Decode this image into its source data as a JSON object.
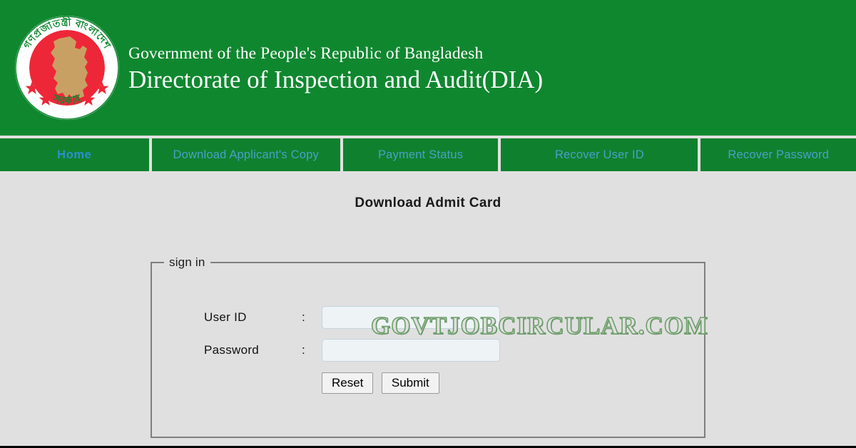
{
  "header": {
    "emblem_name": "bangladesh-government-emblem",
    "emblem_text_top": "গণপ্রজাতন্ত্রী বাংলাদেশ",
    "emblem_text_bottom": "সরকার",
    "line1": "Government of the People's Republic of Bangladesh",
    "line2": "Directorate of Inspection and Audit(DIA)",
    "bg_color": "#0f872f",
    "text_color": "#ffffff"
  },
  "nav": {
    "items": [
      {
        "label": "Home",
        "active": true
      },
      {
        "label": "Download Applicant's Copy",
        "active": false
      },
      {
        "label": "Payment Status",
        "active": false
      },
      {
        "label": "Recover User ID",
        "active": false
      },
      {
        "label": "Recover Password",
        "active": false
      }
    ],
    "active_color": "#2b8fd0",
    "link_color": "#4aa0c8",
    "bg_color": "#0f812e"
  },
  "main": {
    "page_title": "Download Admit Card",
    "form": {
      "legend": "sign in",
      "user_id": {
        "label": "User ID",
        "separator": ":",
        "value": "",
        "placeholder": ""
      },
      "password": {
        "label": "Password",
        "separator": ":",
        "value": "",
        "placeholder": ""
      },
      "reset_label": "Reset",
      "submit_label": "Submit"
    }
  },
  "watermark": {
    "text": "GOVTJOBCIRCULAR.COM",
    "color": "#6f9f6c"
  }
}
